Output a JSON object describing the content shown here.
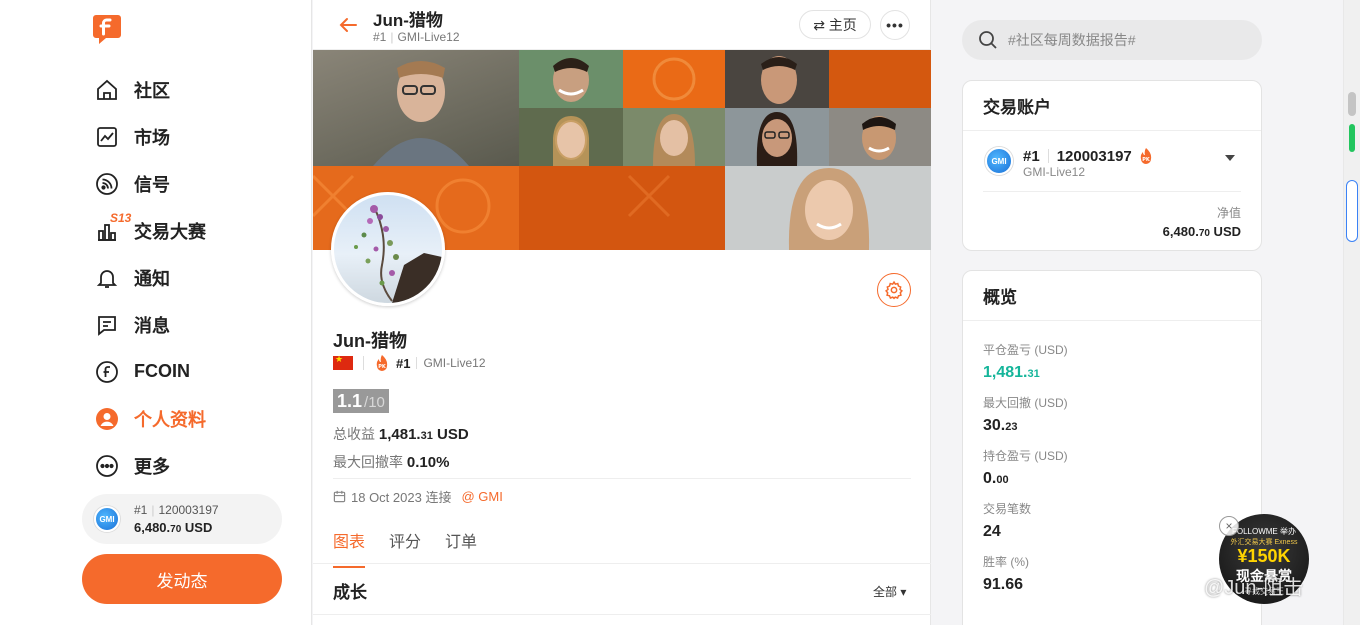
{
  "colors": {
    "accent": "#f56a2c",
    "profit_green": "#15b59a",
    "score_bg": "#999999"
  },
  "sidebar": {
    "logo_icon": "fxchat-logo-icon",
    "items": [
      {
        "label": "社区",
        "icon": "home-icon"
      },
      {
        "label": "市场",
        "icon": "chart-icon"
      },
      {
        "label": "信号",
        "icon": "rss-icon"
      },
      {
        "label": "交易大赛",
        "icon": "bar-chart-icon",
        "badge": "S13"
      },
      {
        "label": "通知",
        "icon": "bell-icon"
      },
      {
        "label": "消息",
        "icon": "message-icon"
      },
      {
        "label": "FCOIN",
        "icon": "coin-icon"
      },
      {
        "label": "个人资料",
        "icon": "user-icon",
        "active": true
      },
      {
        "label": "更多",
        "icon": "more-icon"
      }
    ],
    "account": {
      "broker_logo": "GMI",
      "rank": "#1",
      "id": "120003197",
      "balance_main": "6,480.",
      "balance_dec": "70",
      "currency": " USD"
    },
    "post_button": "发动态"
  },
  "header": {
    "title": "Jun-猎物",
    "rank": "#1",
    "server": "GMI-Live12",
    "home_button": "⇄ 主页",
    "more_button": "•••"
  },
  "profile": {
    "name": "Jun-猎物",
    "rank": "#1",
    "server": "GMI-Live12",
    "score": "1.1",
    "score_max": "/10",
    "total_profit_label": "总收益",
    "total_profit_main": "1,481.",
    "total_profit_dec": "31",
    "total_profit_currency": " USD",
    "max_drawdown_label": "最大回撤率",
    "max_drawdown_value": "0.10%",
    "joined_text": "18 Oct 2023 连接",
    "broker_link": "@ GMI"
  },
  "tabs": [
    {
      "label": "图表",
      "active": true
    },
    {
      "label": "评分"
    },
    {
      "label": "订单"
    }
  ],
  "growth": {
    "title": "成长",
    "filter": "全部 ▾"
  },
  "search": {
    "placeholder": "#社区每周数据报告#"
  },
  "trade_account": {
    "title": "交易账户",
    "broker_logo": "GMI",
    "rank": "#1",
    "id": "120003197",
    "server": "GMI-Live12",
    "net_value_label": "净值",
    "net_value_main": "6,480.",
    "net_value_dec": "70",
    "net_value_currency": " USD"
  },
  "overview": {
    "title": "概览",
    "items": [
      {
        "label": "平仓盈亏 (USD)",
        "main": "1,481.",
        "dec": "31",
        "green": true
      },
      {
        "label": "最大回撤 (USD)",
        "main": "30.",
        "dec": "23"
      },
      {
        "label": "持仓盈亏 (USD)",
        "main": "0.",
        "dec": "00"
      },
      {
        "label": "交易笔数",
        "main": "24",
        "dec": ""
      },
      {
        "label": "胜率 (%)",
        "main": "91.66",
        "dec": ""
      }
    ]
  },
  "promo": {
    "line1": "FOLLOWME 举办",
    "line2": "外汇交易大赛 Exness",
    "line3": "¥150K",
    "line4": "现金悬赏",
    "line5": "寻找交易王",
    "close": "×"
  },
  "watermark": "@Jun-阻击"
}
